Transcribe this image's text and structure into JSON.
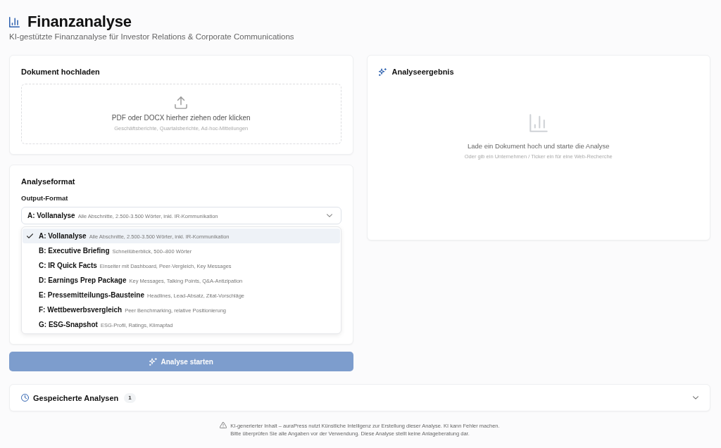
{
  "header": {
    "title": "Finanzanalyse",
    "subtitle": "KI-gestützte Finanzanalyse für Investor Relations & Corporate Communications"
  },
  "upload": {
    "title": "Dokument hochladen",
    "dropzone": {
      "text": "PDF oder DOCX hierher ziehen oder klicken",
      "hint": "Geschäftsberichte, Quartalsberichte, Ad-hoc-Mitteilungen"
    }
  },
  "format": {
    "title": "Analyseformat",
    "label": "Output-Format",
    "select": {
      "value": "A: Vollanalyse",
      "description": "Alle Abschnitte, 2.500-3.500 Wörter, inkl. IR-Kommunikation",
      "expanded": true
    },
    "options": [
      {
        "label": "A: Vollanalyse",
        "description": "Alle Abschnitte, 2.500-3.500 Wörter, inkl. IR-Kommunikation",
        "selected": true
      },
      {
        "label": "B: Executive Briefing",
        "description": "Schnellüberblick, 500–800 Wörter",
        "selected": false
      },
      {
        "label": "C: IR Quick Facts",
        "description": "Einseiter mit Dashboard, Peer-Vergleich, Key Messages",
        "selected": false
      },
      {
        "label": "D: Earnings Prep Package",
        "description": "Key Messages, Talking Points, Q&A-Antizipation",
        "selected": false
      },
      {
        "label": "E: Pressemitteilungs-Bausteine",
        "description": "Headlines, Lead-Absatz, Zitat-Vorschläge",
        "selected": false
      },
      {
        "label": "F: Wettbewerbsvergleich",
        "description": "Peer Benchmarking, relative Positionierung",
        "selected": false
      },
      {
        "label": "G: ESG-Snapshot",
        "description": "ESG-Profil, Ratings, Klimapfad",
        "selected": false
      }
    ]
  },
  "start_button": {
    "label": "Analyse starten",
    "disabled": true
  },
  "result": {
    "title": "Analyseergebnis",
    "empty_text": "Lade ein Dokument hoch und starte die Analyse",
    "empty_hint": "Oder gib ein Unternehmen / Ticker ein für eine Web-Recherche"
  },
  "saved": {
    "title": "Gespeicherte Analysen",
    "count": "1",
    "expanded": false
  },
  "footer": {
    "lines": [
      "KI-generierter Inhalt – auraPress nutzt Künstliche Intelligenz zur Erstellung dieser Analyse. KI kann Fehler machen.",
      "Bitte überprüfen Sie alle Angaben vor der Verwendung. Diese Analyse stellt keine Anlageberatung dar."
    ]
  }
}
